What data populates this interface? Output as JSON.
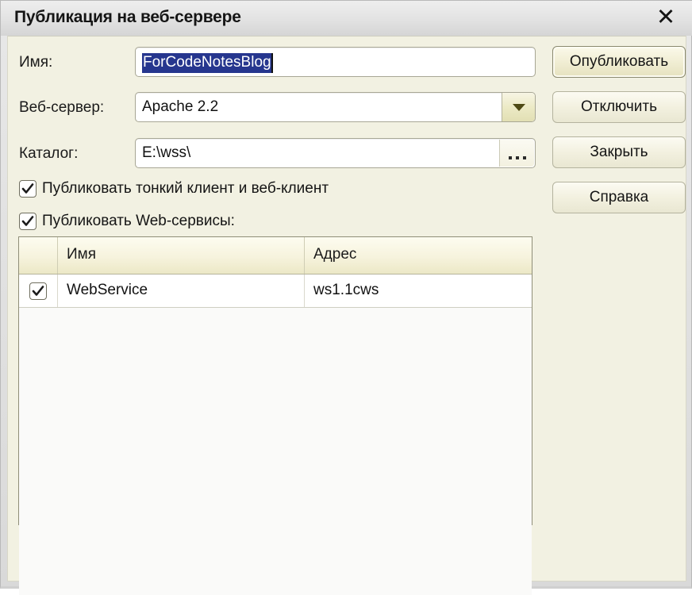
{
  "window": {
    "title": "Публикация на веб-сервере",
    "close_icon": "close-icon",
    "close_glyph": "✕"
  },
  "form": {
    "name_label": "Имя:",
    "name_value": "ForCodeNotesBlog",
    "webserver_label": "Веб-сервер:",
    "webserver_value": "Apache 2.2",
    "webserver_dropdown_icon": "chevron-down-icon",
    "catalog_label": "Каталог:",
    "catalog_value": "E:\\wss\\",
    "catalog_browse_label": "...",
    "checkbox_thin_client": {
      "label": "Публиковать тонкий клиент и веб-клиент",
      "checked": true
    },
    "checkbox_web_services": {
      "label": "Публиковать Web-сервисы:",
      "checked": true
    }
  },
  "buttons": {
    "publish": "Опубликовать",
    "disconnect": "Отключить",
    "close": "Закрыть",
    "help": "Справка"
  },
  "services_table": {
    "columns": [
      "",
      "Имя",
      "Адрес"
    ],
    "rows": [
      {
        "checked": true,
        "name": "WebService",
        "address": "ws1.1cws"
      }
    ]
  },
  "colors": {
    "dialog_background": "#f2f1e2",
    "titlebar": "#e4e4e4",
    "selection_highlight": "#26368e",
    "grid_header": "#f6f3dd",
    "field_border": "#a8a795"
  }
}
